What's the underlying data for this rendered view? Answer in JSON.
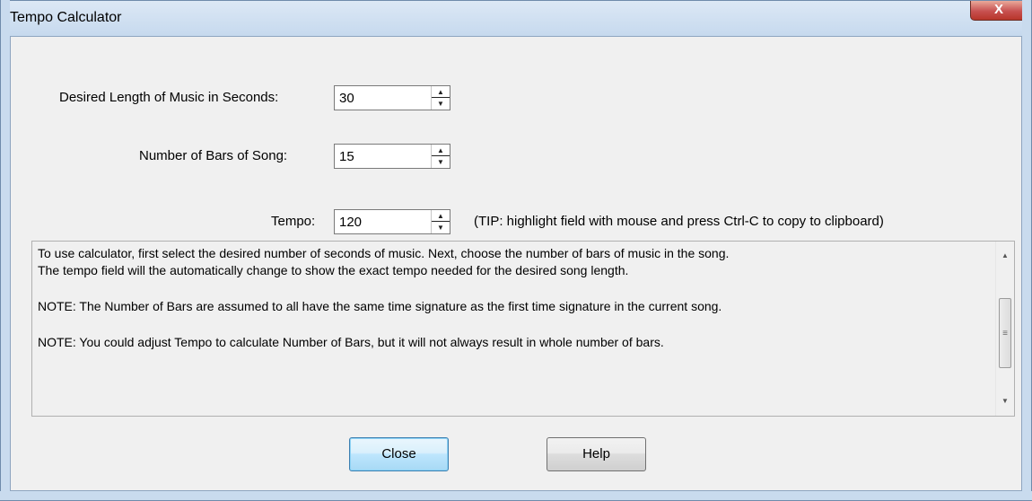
{
  "window": {
    "title": "Tempo Calculator",
    "close_glyph": "X"
  },
  "fields": {
    "seconds": {
      "label": "Desired Length of Music in Seconds:",
      "value": "30"
    },
    "bars": {
      "label": "Number of Bars of Song:",
      "value": "15"
    },
    "tempo": {
      "label": "Tempo:",
      "value": "120",
      "tip": "(TIP: highlight field with mouse and press Ctrl-C to copy to clipboard)"
    }
  },
  "info": {
    "line1": "To use calculator, first select the desired number of seconds of music.  Next, choose the number of bars of music in the song.",
    "line2": "The tempo field will the automatically change to show the exact tempo needed for the desired song length.",
    "line3": "NOTE: The Number of Bars are assumed to all have the same time signature as the first time signature in the current song.",
    "line4": "NOTE: You could adjust Tempo to calculate Number of Bars, but it will not always result in whole number of bars."
  },
  "buttons": {
    "close_label": "Close",
    "help_label": "Help"
  },
  "icons": {
    "spin_up": "▲",
    "spin_down": "▼",
    "scroll_up": "▲",
    "scroll_down": "▼",
    "scroll_grip": "≡"
  }
}
